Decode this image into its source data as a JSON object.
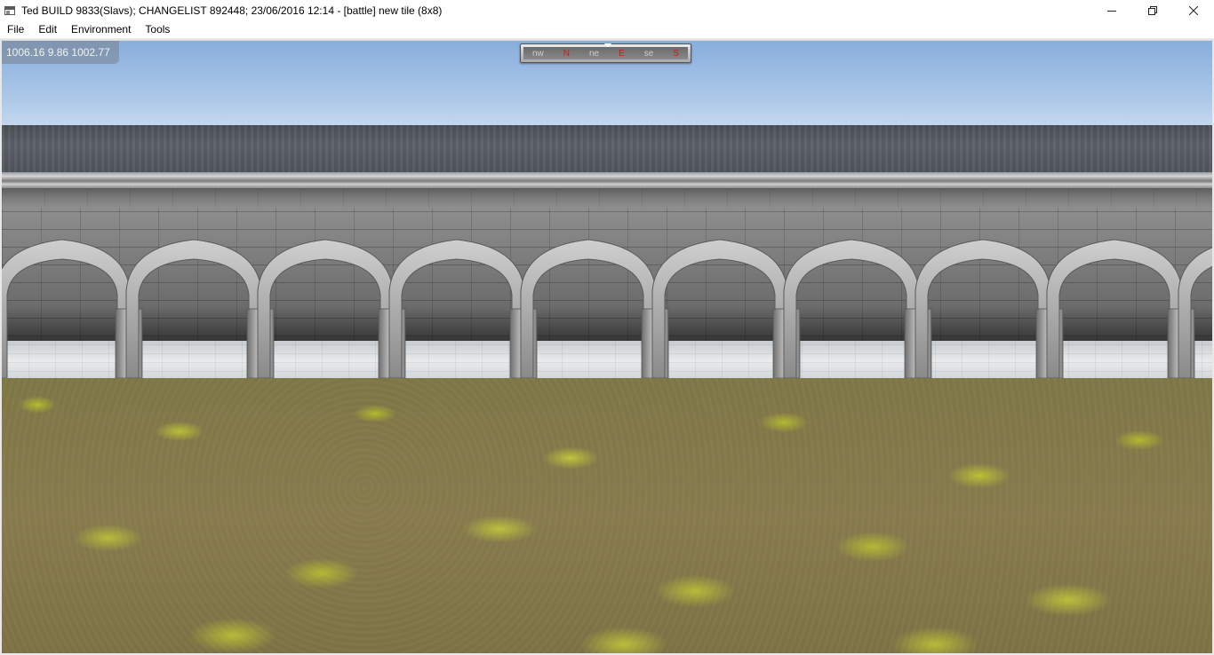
{
  "window": {
    "title": "Ted BUILD 9833(Slavs); CHANGELIST 892448; 23/06/2016 12:14 - [battle] new tile (8x8)",
    "app_icon": "window-app-icon",
    "controls": [
      "minimize-icon",
      "restore-icon",
      "close-icon"
    ]
  },
  "menu": {
    "items": [
      "File",
      "Edit",
      "Environment",
      "Tools"
    ]
  },
  "viewport": {
    "coordinates": "1006.16 9.86 1002.77",
    "compass": {
      "labels": [
        "nw",
        "N",
        "ne",
        "E",
        "se",
        "S"
      ],
      "red_labels": [
        "N",
        "E",
        "S"
      ],
      "accent_red": "#c0201a"
    },
    "colors": {
      "sky": "#a9c6e7",
      "stone": "#8e8e8e",
      "grass": "#8a7f52",
      "moss": "#c8d232"
    }
  }
}
